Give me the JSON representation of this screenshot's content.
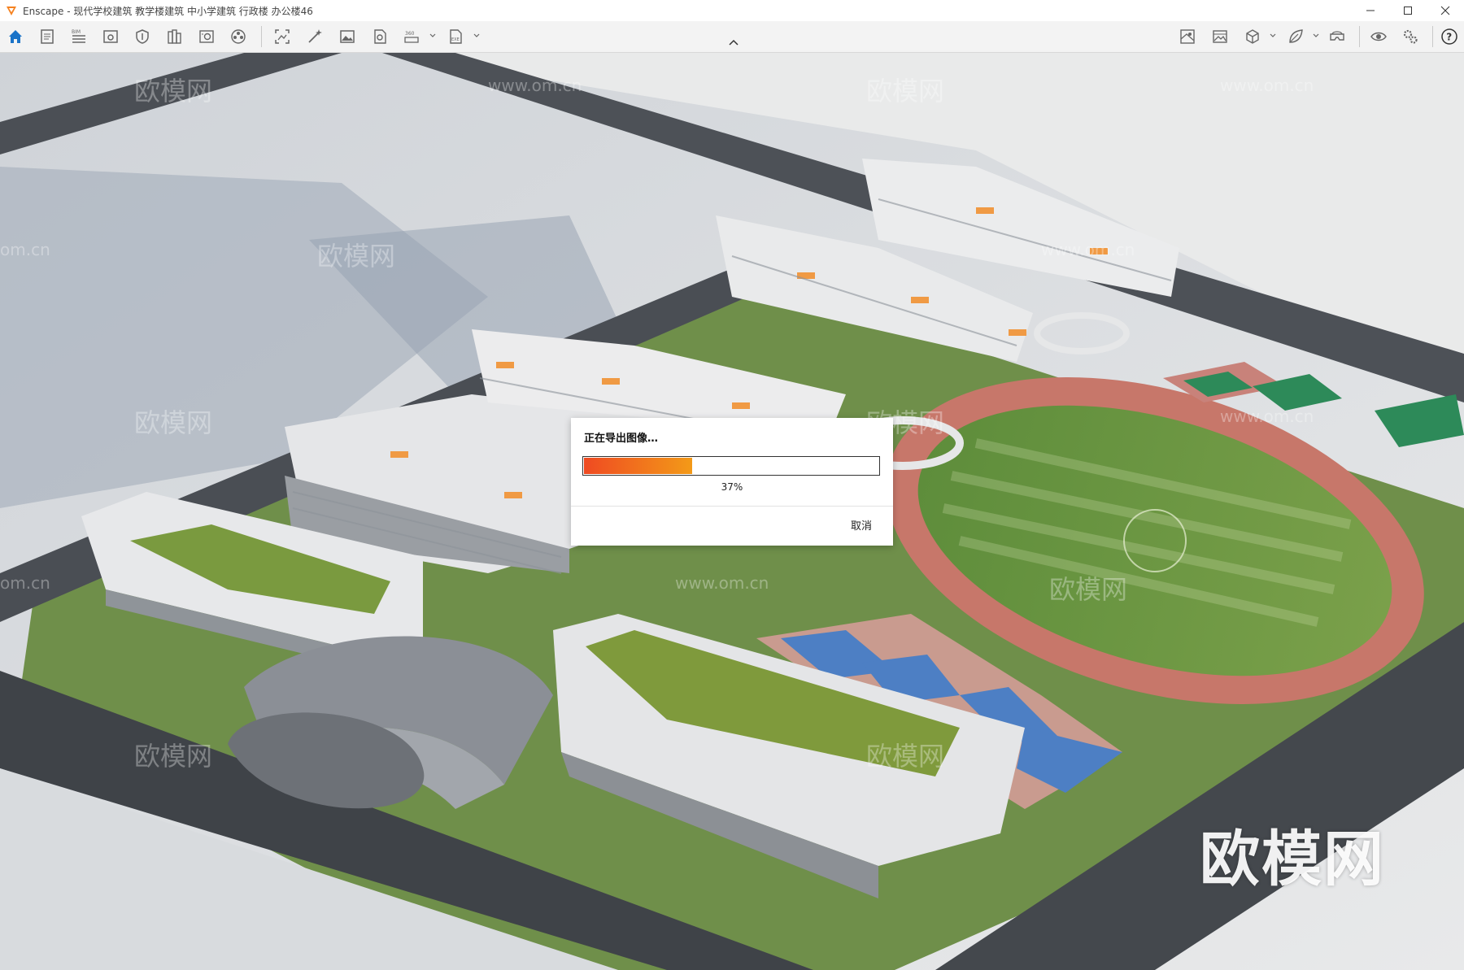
{
  "window": {
    "app_name": "Enscape",
    "title": "Enscape - 现代学校建筑 教学楼建筑 中小学建筑 行政楼 办公楼46",
    "controls": [
      "minimize-icon",
      "maximize-icon",
      "close-icon"
    ]
  },
  "toolbar": {
    "left_icons": [
      "home-icon",
      "document-icon",
      "bim-icon",
      "view-icon",
      "shield-icon",
      "books-icon",
      "settings-panel-icon",
      "film-reel-icon",
      "screenshot-icon",
      "magic-wand-icon",
      "image-icon",
      "batch-render-icon",
      "panorama-360-icon",
      "exe-export-icon"
    ],
    "right_icons": [
      "material-icon",
      "gallery-icon",
      "cube-icon",
      "leaf-icon",
      "vr-headset-icon",
      "eye-icon",
      "gears-icon",
      "help-icon"
    ]
  },
  "watermarks": {
    "cn": "欧模网",
    "url": "www.om.cn",
    "url_fragment": "om.cn",
    "big": "欧模网"
  },
  "dialog": {
    "title": "正在导出图像…",
    "progress_percent": 37,
    "progress_label": "37%",
    "cancel_label": "取消",
    "accent_start": "#ef4a22",
    "accent_end": "#f39a18"
  }
}
